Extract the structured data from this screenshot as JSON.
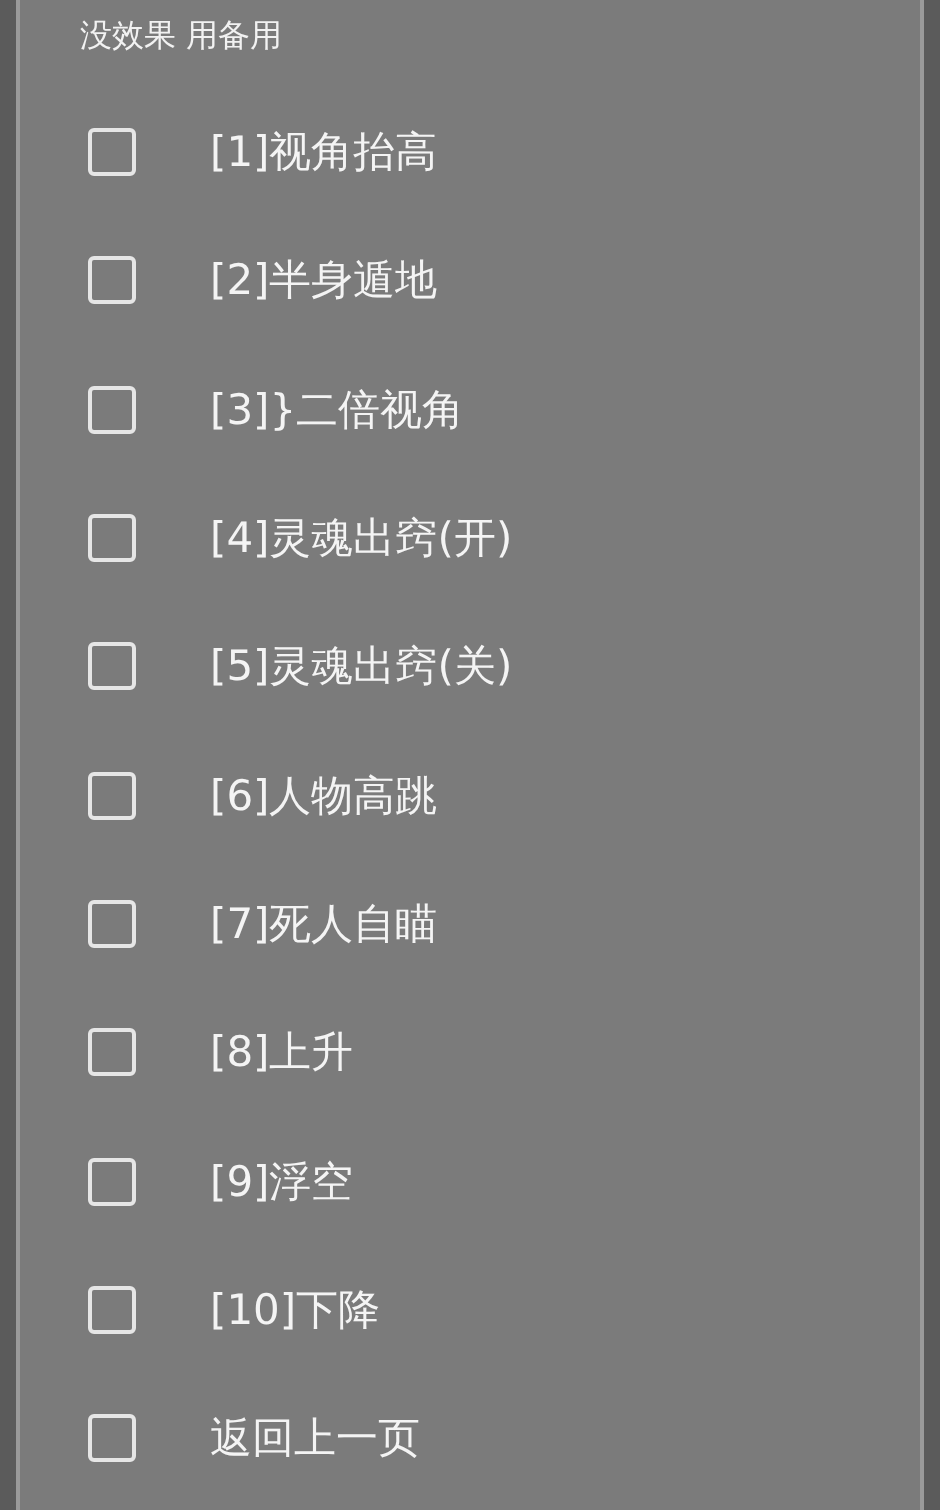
{
  "title": "没效果 用备用",
  "items": [
    {
      "label": "[1]视角抬高",
      "checked": false
    },
    {
      "label": "[2]半身遁地",
      "checked": false
    },
    {
      "label": "[3]}二倍视角",
      "checked": false
    },
    {
      "label": "[4]灵魂出窍(开)",
      "checked": false
    },
    {
      "label": "[5]灵魂出窍(关)",
      "checked": false
    },
    {
      "label": "[6]人物高跳",
      "checked": false
    },
    {
      "label": "[7]死人自瞄",
      "checked": false
    },
    {
      "label": "[8]上升",
      "checked": false
    },
    {
      "label": "[9]浮空",
      "checked": false
    },
    {
      "label": "[10]下降",
      "checked": false
    },
    {
      "label": "返回上一页",
      "checked": false
    }
  ]
}
